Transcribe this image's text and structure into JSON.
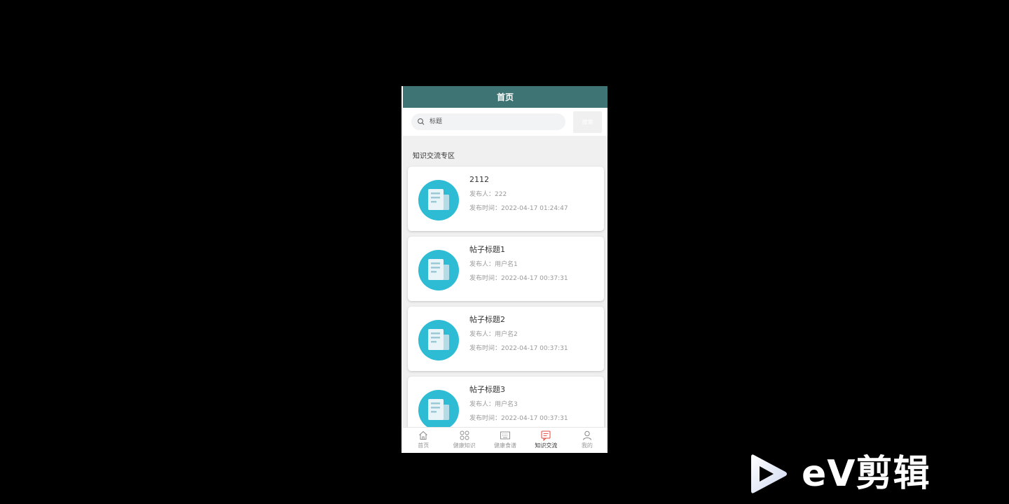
{
  "header": {
    "title": "首页"
  },
  "search": {
    "placeholder": "标题",
    "button_label": "搜索"
  },
  "section": {
    "title": "知识交流专区"
  },
  "posts": [
    {
      "title": "2112",
      "author": "发布人：222",
      "time": "发布时间：2022-04-17 01:24:47"
    },
    {
      "title": "帖子标题1",
      "author": "发布人：用户名1",
      "time": "发布时间：2022-04-17 00:37:31"
    },
    {
      "title": "帖子标题2",
      "author": "发布人：用户名2",
      "time": "发布时间：2022-04-17 00:37:31"
    },
    {
      "title": "帖子标题3",
      "author": "发布人：用户名3",
      "time": "发布时间：2022-04-17 00:37:31"
    }
  ],
  "tabs": [
    {
      "label": "首页",
      "icon": "home-icon"
    },
    {
      "label": "健康知识",
      "icon": "grid-icon"
    },
    {
      "label": "健康食谱",
      "icon": "keyboard-icon"
    },
    {
      "label": "知识交流",
      "icon": "chat-icon",
      "active": true
    },
    {
      "label": "我的",
      "icon": "user-icon"
    }
  ],
  "watermark": {
    "text": "eV剪辑"
  },
  "colors": {
    "header": "#3e7474",
    "thumb": "#2ebcd4",
    "active_tab": "#e0453b",
    "background": "#000000"
  }
}
